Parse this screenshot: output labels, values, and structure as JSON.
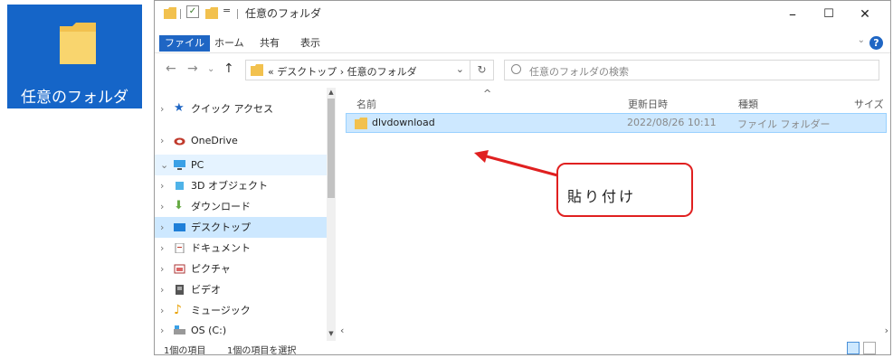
{
  "desktop": {
    "folder_label": "任意のフォルダ"
  },
  "window": {
    "title": "任意のフォルダ",
    "controls": {
      "minimize": "–",
      "maximize": "☐",
      "close": "✕"
    }
  },
  "ribbon": {
    "tabs": [
      "ファイル",
      "ホーム",
      "共有",
      "表示"
    ],
    "collapse_glyph": "⌄",
    "help_glyph": "?"
  },
  "address": {
    "back": "←",
    "forward": "→",
    "recent": "⌄",
    "up": "↑",
    "path": "« デスクトップ › 任意のフォルダ",
    "dropdown": "⌄",
    "refresh": "↻",
    "search_placeholder": "任意のフォルダの検索"
  },
  "nav_pane": {
    "items": [
      {
        "chevron": "›",
        "label": "クイック アクセス",
        "icon": "star-icon"
      },
      {
        "chevron": "›",
        "label": "OneDrive",
        "icon": "cloud-icon"
      },
      {
        "chevron": "⌄",
        "label": "PC",
        "icon": "pc-icon"
      },
      {
        "chevron": "›",
        "label": "3D オブジェクト",
        "icon": "3d-objects-icon"
      },
      {
        "chevron": "›",
        "label": "ダウンロード",
        "icon": "download-icon"
      },
      {
        "chevron": "›",
        "label": "デスクトップ",
        "icon": "desktop-icon"
      },
      {
        "chevron": "›",
        "label": "ドキュメント",
        "icon": "documents-icon"
      },
      {
        "chevron": "›",
        "label": "ピクチャ",
        "icon": "pictures-icon"
      },
      {
        "chevron": "›",
        "label": "ビデオ",
        "icon": "video-icon"
      },
      {
        "chevron": "›",
        "label": "ミュージック",
        "icon": "music-icon"
      },
      {
        "chevron": "›",
        "label": "OS (C:)",
        "icon": "drive-icon"
      }
    ]
  },
  "content": {
    "columns": {
      "name": "名前",
      "date": "更新日時",
      "type": "種類",
      "size": "サイズ"
    },
    "sort_glyph": "^",
    "rows": [
      {
        "name": "dlvdownload",
        "date": "2022/08/26 10:11",
        "type": "ファイル フォルダー"
      }
    ]
  },
  "status": {
    "count": "1個の項目",
    "selected": "1個の項目を選択"
  },
  "annotation": {
    "text": "貼り付け",
    "color": "#e02020"
  },
  "colors": {
    "accent": "#1f66c4",
    "selection": "#cde8ff",
    "folder": "#f5c74e"
  }
}
